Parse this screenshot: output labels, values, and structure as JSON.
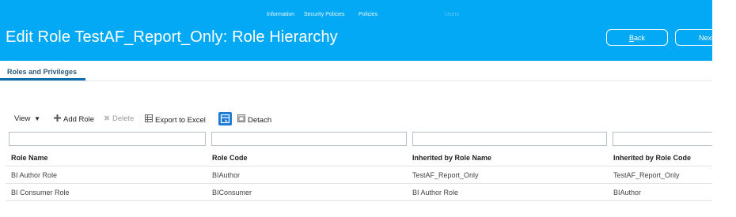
{
  "top_nav": [
    "Information",
    "Security Policies",
    "Policies",
    "Users"
  ],
  "page_title": "Edit Role TestAF_Report_Only: Role Hierarchy",
  "buttons": {
    "back_prefix": "",
    "back_u": "B",
    "back_rest": "ack",
    "next": "Next"
  },
  "tabs": [
    {
      "label": "Roles and Privileges"
    }
  ],
  "toolbar": {
    "view": "View",
    "add_role": "Add Role",
    "delete": "Delete",
    "export": "Export to Excel",
    "detach": "Detach"
  },
  "filters": [
    {
      "placeholder": "",
      "value": ""
    },
    {
      "placeholder": "",
      "value": ""
    },
    {
      "placeholder": "",
      "value": ""
    },
    {
      "placeholder": "",
      "value": ""
    }
  ],
  "table": {
    "columns": [
      "Role Name",
      "Role Code",
      "Inherited by Role Name",
      "Inherited by Role Code"
    ],
    "rows": [
      [
        "BI Author Role",
        "BIAuthor",
        "TestAF_Report_Only",
        "TestAF_Report_Only"
      ],
      [
        "BI Consumer Role",
        "BIConsumer",
        "BI Author Role",
        "BIAuthor"
      ]
    ]
  },
  "colors": {
    "header_bg": "#03a9f4",
    "tab_text": "#2c5a7a",
    "tab_underline": "#0f6dac",
    "detach_highlight": "#1c7cd5"
  },
  "icons": {
    "view": "caret-down-icon",
    "add": "plus-icon",
    "delete": "x-icon",
    "export": "spreadsheet-icon",
    "freeze": "freeze-column-icon",
    "detach": "detach-icon"
  }
}
